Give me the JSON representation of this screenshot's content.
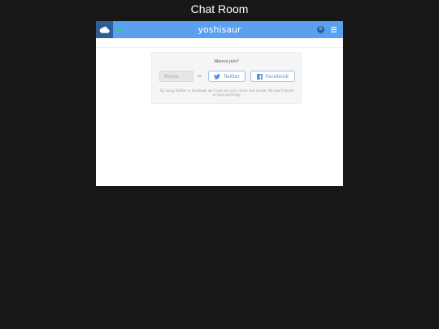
{
  "page": {
    "title": "Chat Room"
  },
  "topbar": {
    "room_name": "yoshisaur",
    "user_count": "0",
    "icons": {
      "cloud": "cloud-icon",
      "status": "online-status-icon",
      "menu": "hamburger-menu-icon"
    }
  },
  "join": {
    "heading": "Wanna join?",
    "name_placeholder": "Name",
    "or_label": "or",
    "twitter_label": "Twitter",
    "facebook_label": "Facebook",
    "disclaimer": "By using Twitter or Facebook we'll just use your name and avatar. We won't tweet or post anything."
  },
  "colors": {
    "background": "#171717",
    "topbar": "#5b9ff0",
    "topbar_dark": "#2f5e97",
    "status_online": "#2fd47a",
    "social_text": "#5b8fd6"
  }
}
